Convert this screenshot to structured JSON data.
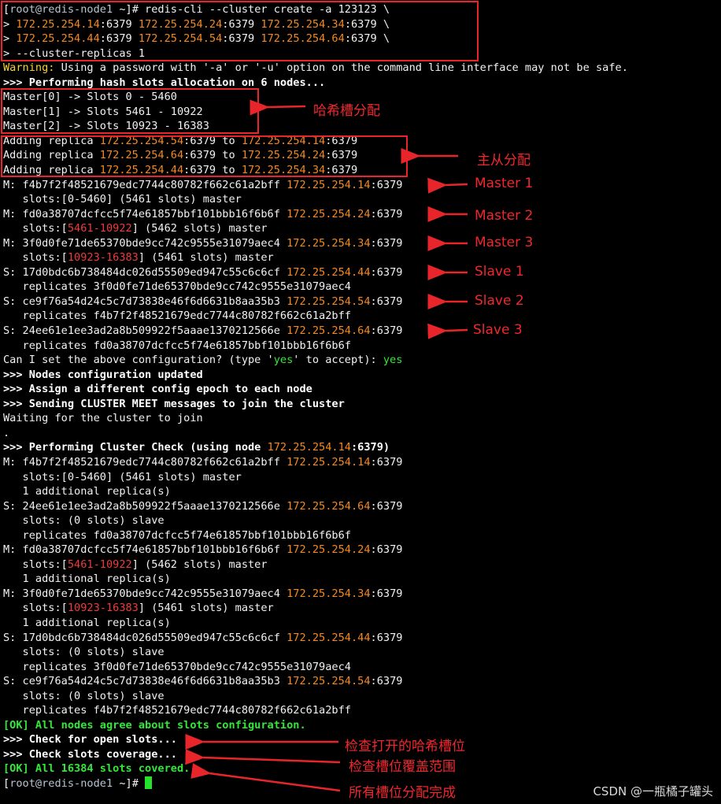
{
  "terminal": {
    "lines": [
      [
        [
          "[",
          "c-white"
        ],
        [
          "root@redis-node1",
          "c-gray"
        ],
        [
          " ~]# redis-cli --cluster create -a 123123 \\",
          "c-white"
        ]
      ],
      [
        [
          "> ",
          "c-white"
        ],
        [
          "172.25.254.14",
          "c-orange"
        ],
        [
          ":6379 ",
          "c-white"
        ],
        [
          "172.25.254.24",
          "c-orange"
        ],
        [
          ":6379 ",
          "c-white"
        ],
        [
          "172.25.254.34",
          "c-orange"
        ],
        [
          ":6379 \\",
          "c-white"
        ]
      ],
      [
        [
          "> ",
          "c-white"
        ],
        [
          "172.25.254.44",
          "c-orange"
        ],
        [
          ":6379 ",
          "c-white"
        ],
        [
          "172.25.254.54",
          "c-orange"
        ],
        [
          ":6379 ",
          "c-white"
        ],
        [
          "172.25.254.64",
          "c-orange"
        ],
        [
          ":6379 \\",
          "c-white"
        ]
      ],
      [
        [
          "> --cluster-replicas 1",
          "c-white"
        ]
      ],
      [
        [
          "Warning:",
          "c-yellow"
        ],
        [
          " Using a password with '-a' or '-u' option on the command line interface may not be safe.",
          "c-white"
        ]
      ],
      [
        [
          ">>> Performing hash slots allocation on 6 nodes...",
          "c-bold"
        ]
      ],
      [
        [
          "Master[0] -> Slots 0 - 5460",
          "c-white"
        ]
      ],
      [
        [
          "Master[1] -> Slots 5461 - 10922",
          "c-white"
        ]
      ],
      [
        [
          "Master[2] -> Slots 10923 - 16383",
          "c-white"
        ]
      ],
      [
        [
          "Adding replica ",
          "c-white"
        ],
        [
          "172.25.254.54",
          "c-orange"
        ],
        [
          ":6379 to ",
          "c-white"
        ],
        [
          "172.25.254.14",
          "c-orange"
        ],
        [
          ":6379",
          "c-white"
        ]
      ],
      [
        [
          "Adding replica ",
          "c-white"
        ],
        [
          "172.25.254.64",
          "c-orange"
        ],
        [
          ":6379 to ",
          "c-white"
        ],
        [
          "172.25.254.24",
          "c-orange"
        ],
        [
          ":6379",
          "c-white"
        ]
      ],
      [
        [
          "Adding replica ",
          "c-white"
        ],
        [
          "172.25.254.44",
          "c-orange"
        ],
        [
          ":6379 to ",
          "c-white"
        ],
        [
          "172.25.254.34",
          "c-orange"
        ],
        [
          ":6379",
          "c-white"
        ]
      ],
      [
        [
          "M: f4b7f2f48521679edc7744c80782f662c61a2bff ",
          "c-white"
        ],
        [
          "172.25.254.14",
          "c-orange"
        ],
        [
          ":6379",
          "c-white"
        ]
      ],
      [
        [
          "   slots:[0-5460] (5461 slots) master",
          "c-white"
        ]
      ],
      [
        [
          "M: fd0a38707dcfcc5f74e61857bbf101bbb16f6b6f ",
          "c-white"
        ],
        [
          "172.25.254.24",
          "c-orange"
        ],
        [
          ":6379",
          "c-white"
        ]
      ],
      [
        [
          "   slots:[",
          "c-white"
        ],
        [
          "5461-10922",
          "c-red"
        ],
        [
          "] (5462 slots) master",
          "c-white"
        ]
      ],
      [
        [
          "M: 3f0d0fe71de65370bde9cc742c9555e31079aec4 ",
          "c-white"
        ],
        [
          "172.25.254.34",
          "c-orange"
        ],
        [
          ":6379",
          "c-white"
        ]
      ],
      [
        [
          "   slots:[",
          "c-white"
        ],
        [
          "10923-16383",
          "c-red"
        ],
        [
          "] (5461 slots) master",
          "c-white"
        ]
      ],
      [
        [
          "S: 17d0bdc6b738484dc026d55509ed947c55c6c6cf ",
          "c-white"
        ],
        [
          "172.25.254.44",
          "c-orange"
        ],
        [
          ":6379",
          "c-white"
        ]
      ],
      [
        [
          "   replicates 3f0d0fe71de65370bde9cc742c9555e31079aec4",
          "c-white"
        ]
      ],
      [
        [
          "S: ce9f76a54d24c5c7d73838e46f6d6631b8aa35b3 ",
          "c-white"
        ],
        [
          "172.25.254.54",
          "c-orange"
        ],
        [
          ":6379",
          "c-white"
        ]
      ],
      [
        [
          "   replicates f4b7f2f48521679edc7744c80782f662c61a2bff",
          "c-white"
        ]
      ],
      [
        [
          "S: 24ee61e1ee3ad2a8b509922f5aaae1370212566e ",
          "c-white"
        ],
        [
          "172.25.254.64",
          "c-orange"
        ],
        [
          ":6379",
          "c-white"
        ]
      ],
      [
        [
          "   replicates fd0a38707dcfcc5f74e61857bbf101bbb16f6b6f",
          "c-white"
        ]
      ],
      [
        [
          "Can I set the above configuration? (type '",
          "c-white"
        ],
        [
          "yes",
          "c-green"
        ],
        [
          "' to accept): ",
          "c-white"
        ],
        [
          "yes",
          "c-green"
        ]
      ],
      [
        [
          ">>> Nodes configuration updated",
          "c-bold"
        ]
      ],
      [
        [
          ">>> Assign a different config epoch to each node",
          "c-bold"
        ]
      ],
      [
        [
          ">>> Sending CLUSTER MEET messages to join the cluster",
          "c-bold"
        ]
      ],
      [
        [
          "Waiting for the cluster to join",
          "c-white"
        ]
      ],
      [
        [
          ".",
          "c-white"
        ]
      ],
      [
        [
          ">>> Performing Cluster Check (using node ",
          "c-bold"
        ],
        [
          "172.25.254.14",
          "c-orange"
        ],
        [
          ":6379)",
          "c-bold"
        ]
      ],
      [
        [
          "M: f4b7f2f48521679edc7744c80782f662c61a2bff ",
          "c-white"
        ],
        [
          "172.25.254.14",
          "c-orange"
        ],
        [
          ":6379",
          "c-white"
        ]
      ],
      [
        [
          "   slots:[0-5460] (5461 slots) master",
          "c-white"
        ]
      ],
      [
        [
          "   1 additional replica(s)",
          "c-white"
        ]
      ],
      [
        [
          "S: 24ee61e1ee3ad2a8b509922f5aaae1370212566e ",
          "c-white"
        ],
        [
          "172.25.254.64",
          "c-orange"
        ],
        [
          ":6379",
          "c-white"
        ]
      ],
      [
        [
          "   slots: (0 slots) slave",
          "c-white"
        ]
      ],
      [
        [
          "   replicates fd0a38707dcfcc5f74e61857bbf101bbb16f6b6f",
          "c-white"
        ]
      ],
      [
        [
          "M: fd0a38707dcfcc5f74e61857bbf101bbb16f6b6f ",
          "c-white"
        ],
        [
          "172.25.254.24",
          "c-orange"
        ],
        [
          ":6379",
          "c-white"
        ]
      ],
      [
        [
          "   slots:[",
          "c-white"
        ],
        [
          "5461-10922",
          "c-red"
        ],
        [
          "] (5462 slots) master",
          "c-white"
        ]
      ],
      [
        [
          "   1 additional replica(s)",
          "c-white"
        ]
      ],
      [
        [
          "M: 3f0d0fe71de65370bde9cc742c9555e31079aec4 ",
          "c-white"
        ],
        [
          "172.25.254.34",
          "c-orange"
        ],
        [
          ":6379",
          "c-white"
        ]
      ],
      [
        [
          "   slots:[",
          "c-white"
        ],
        [
          "10923-16383",
          "c-red"
        ],
        [
          "] (5461 slots) master",
          "c-white"
        ]
      ],
      [
        [
          "   1 additional replica(s)",
          "c-white"
        ]
      ],
      [
        [
          "S: 17d0bdc6b738484dc026d55509ed947c55c6c6cf ",
          "c-white"
        ],
        [
          "172.25.254.44",
          "c-orange"
        ],
        [
          ":6379",
          "c-white"
        ]
      ],
      [
        [
          "   slots: (0 slots) slave",
          "c-white"
        ]
      ],
      [
        [
          "   replicates 3f0d0fe71de65370bde9cc742c9555e31079aec4",
          "c-white"
        ]
      ],
      [
        [
          "S: ce9f76a54d24c5c7d73838e46f6d6631b8aa35b3 ",
          "c-white"
        ],
        [
          "172.25.254.54",
          "c-orange"
        ],
        [
          ":6379",
          "c-white"
        ]
      ],
      [
        [
          "   slots: (0 slots) slave",
          "c-white"
        ]
      ],
      [
        [
          "   replicates f4b7f2f48521679edc7744c80782f662c61a2bff",
          "c-white"
        ]
      ],
      [
        [
          "[OK] All nodes agree about slots configuration.",
          "c-okgreen"
        ]
      ],
      [
        [
          ">>> Check for open slots...",
          "c-bold"
        ]
      ],
      [
        [
          ">>> Check slots coverage...",
          "c-bold"
        ]
      ],
      [
        [
          "[OK] All 16384 slots covered.",
          "c-okgreen"
        ]
      ],
      [
        [
          "[",
          "c-white"
        ],
        [
          "root@redis-node1",
          "c-gray"
        ],
        [
          " ~]# ",
          "c-white"
        ]
      ]
    ]
  },
  "annotations": {
    "hash_slots": "哈希槽分配",
    "master_slave": "主从分配",
    "master1": "Master 1",
    "master2": "Master 2",
    "master3": "Master 3",
    "slave1": "Slave 1",
    "slave2": "Slave 2",
    "slave3": "Slave 3",
    "open_slots": "检查打开的哈希槽位",
    "coverage": "检查槽位覆盖范围",
    "done": "所有槽位分配完成"
  },
  "watermark": "CSDN @一瓶橘子罐头",
  "colors": {
    "annotation_red": "#f0282e",
    "ip_orange": "#f5891f",
    "ok_green": "#35e63a"
  }
}
